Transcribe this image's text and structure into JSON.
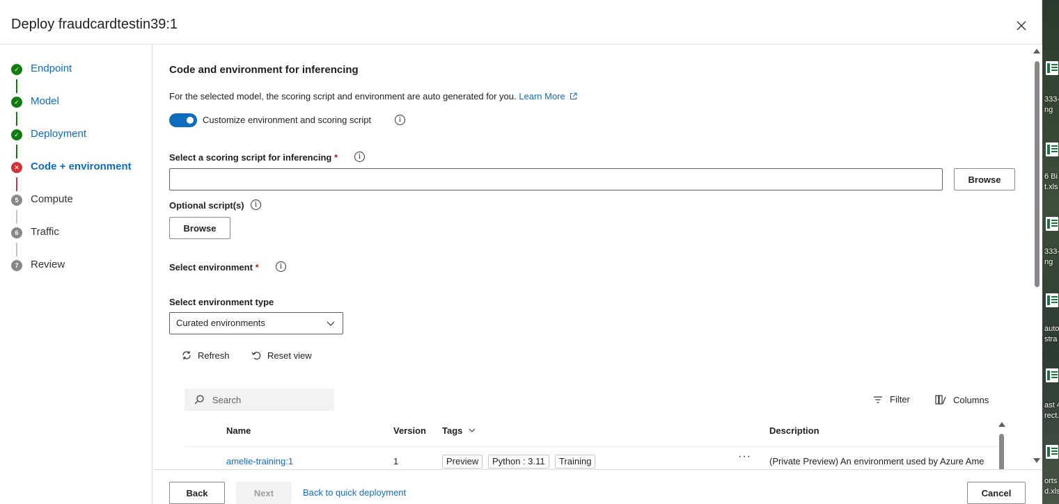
{
  "dialog": {
    "title": "Deploy fraudcardtestin39:1",
    "close_icon": "close-icon"
  },
  "steps": [
    {
      "label": "Endpoint",
      "state": "done",
      "marker": "✓"
    },
    {
      "label": "Model",
      "state": "done",
      "marker": "✓"
    },
    {
      "label": "Deployment",
      "state": "done",
      "marker": "✓"
    },
    {
      "label": "Code + environment",
      "state": "error",
      "marker": "✕"
    },
    {
      "label": "Compute",
      "state": "todo",
      "marker": "5"
    },
    {
      "label": "Traffic",
      "state": "todo",
      "marker": "6"
    },
    {
      "label": "Review",
      "state": "todo",
      "marker": "7"
    }
  ],
  "main": {
    "section_title": "Code and environment for inferencing",
    "description": "For the selected model, the scoring script and environment are auto generated for you.",
    "learn_more": "Learn More",
    "toggle_label": "Customize environment and scoring script",
    "toggle_on": true,
    "scoring_label": "Select a scoring script for inferencing",
    "scoring_value": "",
    "browse_label": "Browse",
    "optional_label": "Optional script(s)",
    "optional_browse_label": "Browse",
    "env_label": "Select environment",
    "env_type_label": "Select environment type",
    "env_type_value": "Curated environments",
    "required_mark": "*",
    "info_glyph": "i"
  },
  "toolbar": {
    "refresh": "Refresh",
    "reset_view": "Reset view",
    "filter": "Filter",
    "columns": "Columns"
  },
  "grid": {
    "search_placeholder": "Search",
    "columns": {
      "name": "Name",
      "version": "Version",
      "tags": "Tags",
      "description": "Description"
    },
    "rows": [
      {
        "name": "amelie-training:1",
        "version": "1",
        "tags": [
          "Preview",
          "Python : 3.11",
          "Training"
        ],
        "more": "···",
        "description": "(Private Preview) An environment used by Azure Ame"
      }
    ]
  },
  "footer": {
    "back": "Back",
    "next": "Next",
    "quick_link": "Back to quick deployment",
    "cancel": "Cancel"
  },
  "desktop": {
    "labels": [
      "333-\nng",
      "6 Bi\nt.xls",
      "333-\nng",
      "auto\nstra",
      "ast 4\nrect.",
      "orts\nd.xls"
    ]
  },
  "colors": {
    "accent": "#0f6cbd",
    "success": "#107c10",
    "error": "#d13438",
    "pending": "#8a8886"
  }
}
